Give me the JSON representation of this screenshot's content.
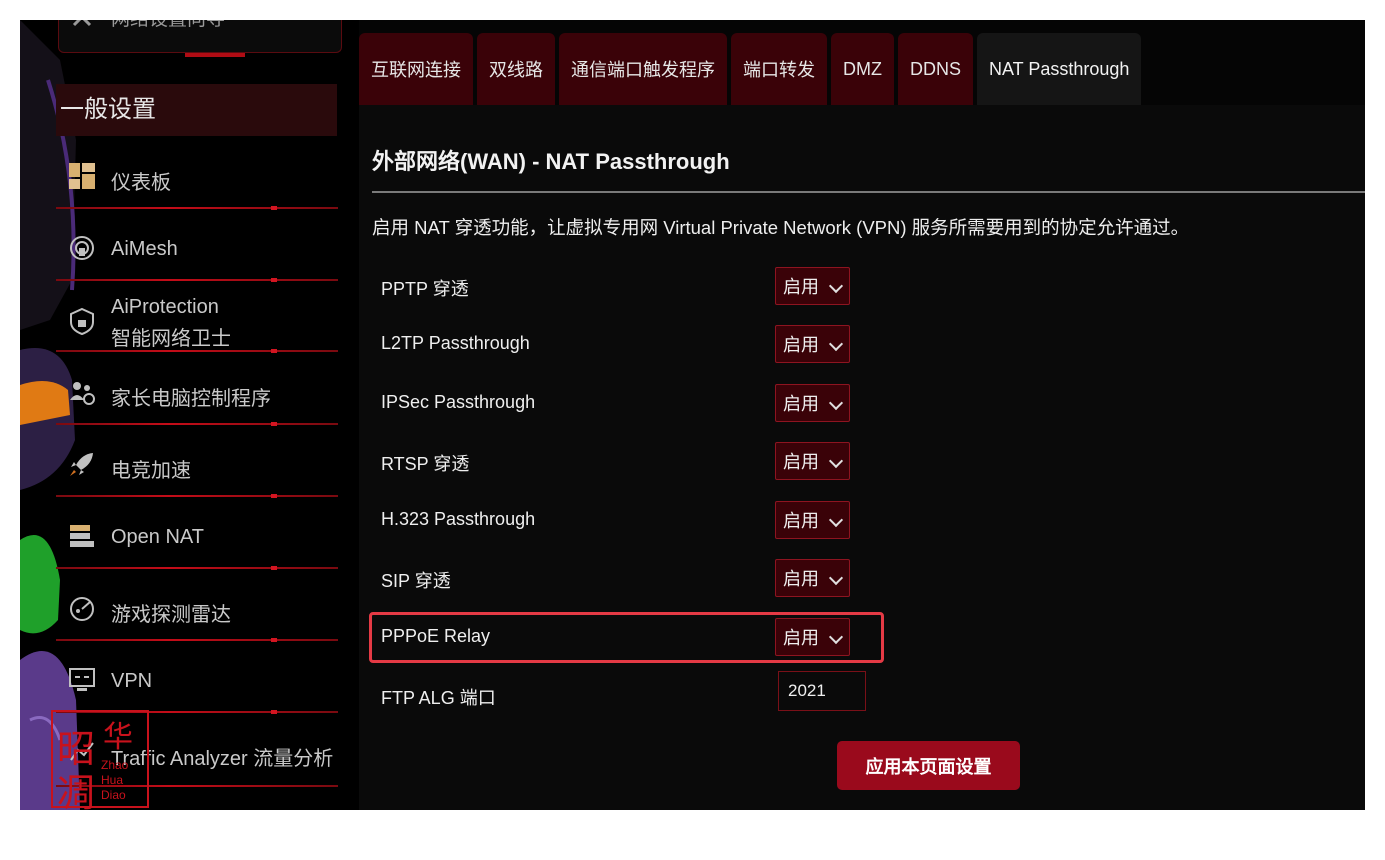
{
  "sidebar": {
    "top_item": "网络设置向导",
    "group_title": "一般设置",
    "items": [
      {
        "label": "仪表板",
        "icon": "dashboard-icon"
      },
      {
        "label": "AiMesh",
        "icon": "aimesh-icon"
      },
      {
        "label": "AiProtection",
        "label2": "智能网络卫士",
        "icon": "shield-lock-icon"
      },
      {
        "label": "家长电脑控制程序",
        "icon": "parental-control-icon"
      },
      {
        "label": "电竞加速",
        "icon": "rocket-icon"
      },
      {
        "label": "Open NAT",
        "icon": "open-nat-icon"
      },
      {
        "label": "游戏探测雷达",
        "icon": "game-radar-icon"
      },
      {
        "label": "VPN",
        "icon": "vpn-icon"
      },
      {
        "label": "Traffic Analyzer 流量分析",
        "icon": "traffic-analyzer-icon"
      }
    ]
  },
  "tabs": [
    {
      "label": "互联网连接"
    },
    {
      "label": "双线路"
    },
    {
      "label": "通信端口触发程序"
    },
    {
      "label": "端口转发"
    },
    {
      "label": "DMZ"
    },
    {
      "label": "DDNS"
    },
    {
      "label": "NAT Passthrough",
      "active": true
    }
  ],
  "page": {
    "title": "外部网络(WAN) - NAT Passthrough",
    "description": "启用 NAT 穿透功能，让虚拟专用网 Virtual Private Network (VPN) 服务所需要用到的协定允许通过。"
  },
  "settings": [
    {
      "label": "PPTP 穿透",
      "value": "启用"
    },
    {
      "label": "L2TP Passthrough",
      "value": "启用"
    },
    {
      "label": "IPSec Passthrough",
      "value": "启用"
    },
    {
      "label": "RTSP 穿透",
      "value": "启用"
    },
    {
      "label": "H.323 Passthrough",
      "value": "启用"
    },
    {
      "label": "SIP 穿透",
      "value": "启用"
    },
    {
      "label": "PPPoE Relay",
      "value": "启用",
      "highlighted": true
    }
  ],
  "ftp_alg": {
    "label": "FTP ALG 端口",
    "value": "2021"
  },
  "apply_button": "应用本页面设置",
  "watermark": {
    "glyph1": "昭",
    "glyph2": "华",
    "glyph3": "凋",
    "small1": "Zhao",
    "small2": "Hua",
    "small3": "Diao"
  },
  "colors": {
    "accent": "#3a0208",
    "highlight": "#e53a45",
    "button": "#9a0a1c"
  }
}
